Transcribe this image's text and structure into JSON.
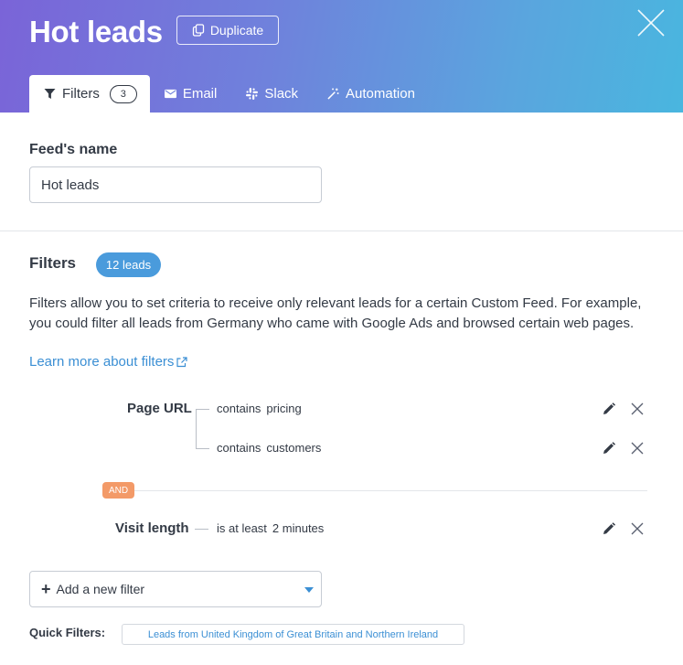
{
  "header": {
    "title": "Hot leads",
    "duplicate_label": "Duplicate",
    "gradient": [
      "#7a64d8",
      "#49b6df"
    ]
  },
  "tabs": [
    {
      "label": "Filters",
      "icon": "filter-icon",
      "badge": "3",
      "active": true
    },
    {
      "label": "Email",
      "icon": "envelope-icon"
    },
    {
      "label": "Slack",
      "icon": "slack-icon"
    },
    {
      "label": "Automation",
      "icon": "magic-wand-icon"
    }
  ],
  "feed": {
    "name_label": "Feed's name",
    "name_value": "Hot leads"
  },
  "filters": {
    "heading": "Filters",
    "leads_count": "12 leads",
    "description": "Filters allow you to set criteria to receive only relevant leads for a certain Custom Feed. For example, you could filter all leads from Germany who came with Google Ads and browsed certain web pages.",
    "learn_more": "Learn more about filters",
    "rules": [
      {
        "label": "Page URL",
        "conditions": [
          {
            "operator": "contains",
            "value": "pricing"
          },
          {
            "operator": "contains",
            "value": "customers"
          }
        ]
      },
      {
        "label": "Visit length",
        "conditions": [
          {
            "operator": "is at least",
            "value": "2 minutes"
          }
        ]
      }
    ],
    "joiner": "AND",
    "add_filter_label": "Add a new filter",
    "quick_filters_label": "Quick Filters:",
    "quick_filters": [
      "Leads from United Kingdom of Great Britain and Northern Ireland"
    ]
  },
  "colors": {
    "accent": "#3b8fd4",
    "leads_pill": "#4a9bdc",
    "and_badge": "#f39a68"
  }
}
